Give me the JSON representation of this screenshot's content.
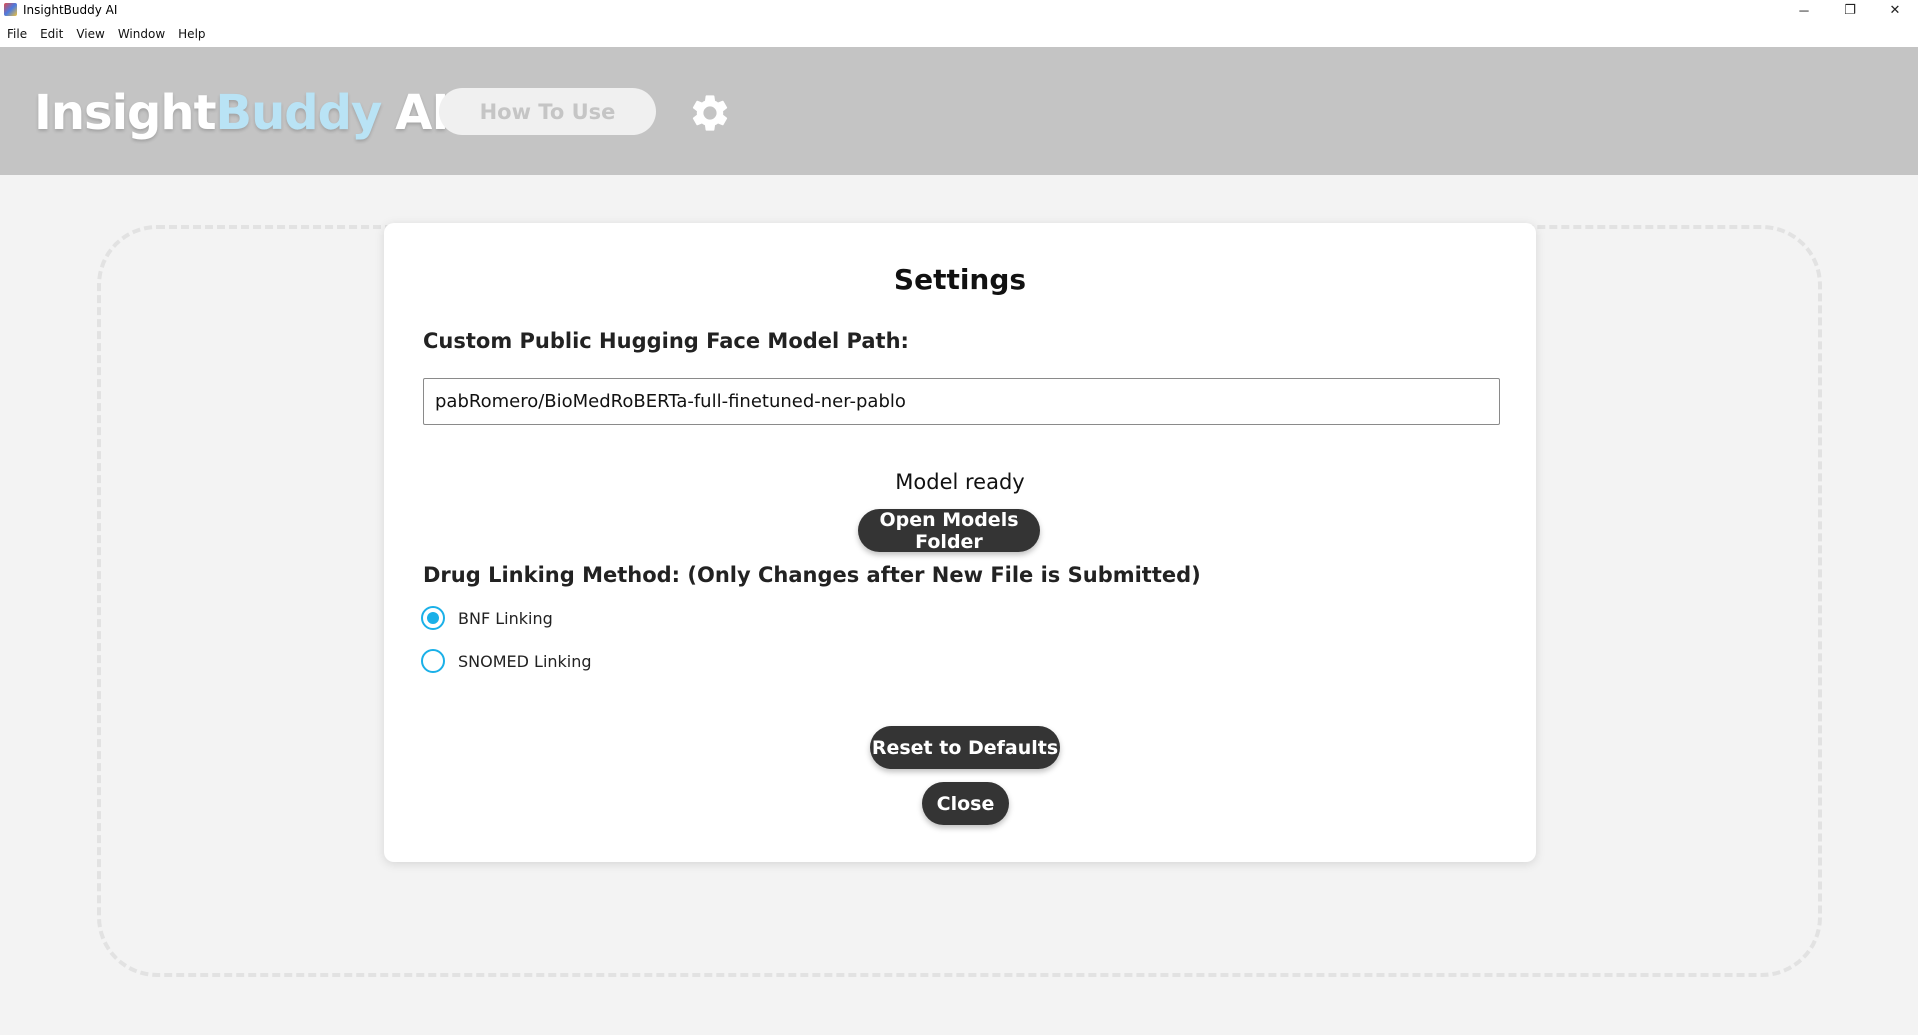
{
  "window": {
    "title": "InsightBuddy AI",
    "minimize_glyph": "─",
    "maximize_glyph": "❐",
    "close_glyph": "✕"
  },
  "menu": {
    "items": [
      "File",
      "Edit",
      "View",
      "Window",
      "Help"
    ]
  },
  "header": {
    "brand_part1": "Insight",
    "brand_part2": "Buddy",
    "brand_part3": "AI",
    "how_to_use_label": "How To Use",
    "settings_icon": "gear-icon"
  },
  "settings": {
    "title": "Settings",
    "model_path_label": "Custom Public Hugging Face Model Path:",
    "model_path_value": "pabRomero/BioMedRoBERTa-full-finetuned-ner-pablo",
    "model_status": "Model ready",
    "open_models_folder_label": "Open Models Folder",
    "drug_linking_label": "Drug Linking Method: (Only Changes after New File is Submitted)",
    "linking_options": [
      {
        "label": "BNF Linking",
        "selected": true
      },
      {
        "label": "SNOMED Linking",
        "selected": false
      }
    ],
    "reset_label": "Reset to Defaults",
    "close_label": "Close"
  },
  "colors": {
    "accent": "#1ab0e8",
    "header_bg": "#c4c4c4",
    "button_dark": "#343434",
    "brand_highlight": "#b9e3f5"
  }
}
